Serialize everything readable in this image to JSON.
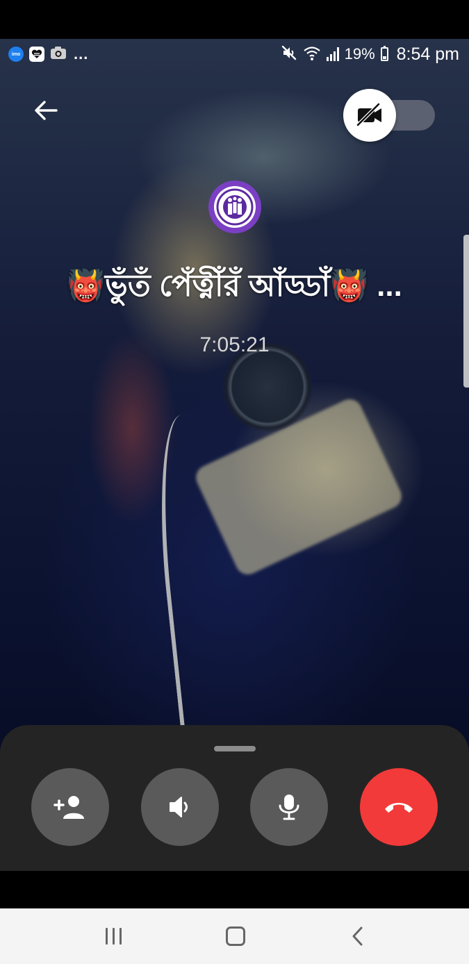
{
  "status_bar": {
    "left_icons": [
      "imo-icon",
      "app-heart-icon",
      "camera-icon"
    ],
    "imo_label": "imo",
    "more_text": "...",
    "right_icons": [
      "mute-icon",
      "wifi-icon",
      "signal-icon",
      "battery-icon"
    ],
    "battery_percent": "19%",
    "time": "8:54 pm"
  },
  "call": {
    "group_name": "👹ভুঁতঁ পেঁত্নীঁরঁ আঁড্ডাঁ👹 ...",
    "duration": "7:05:21",
    "video_toggle": {
      "state": "off",
      "icon": "video-off-icon"
    },
    "back_icon": "back-arrow-icon"
  },
  "controls": [
    {
      "name": "add-participant-button",
      "icon": "add-person-icon"
    },
    {
      "name": "speaker-button",
      "icon": "speaker-icon"
    },
    {
      "name": "microphone-button",
      "icon": "microphone-icon"
    },
    {
      "name": "end-call-button",
      "icon": "hang-up-icon"
    }
  ],
  "colors": {
    "end_call": "#f23a3a",
    "control_bg": "#5a5a5a",
    "panel_bg": "#242424",
    "avatar_ring": "#7b3fc4"
  },
  "navigation_bar": {
    "buttons": [
      "recents-icon",
      "home-icon",
      "back-icon"
    ]
  }
}
